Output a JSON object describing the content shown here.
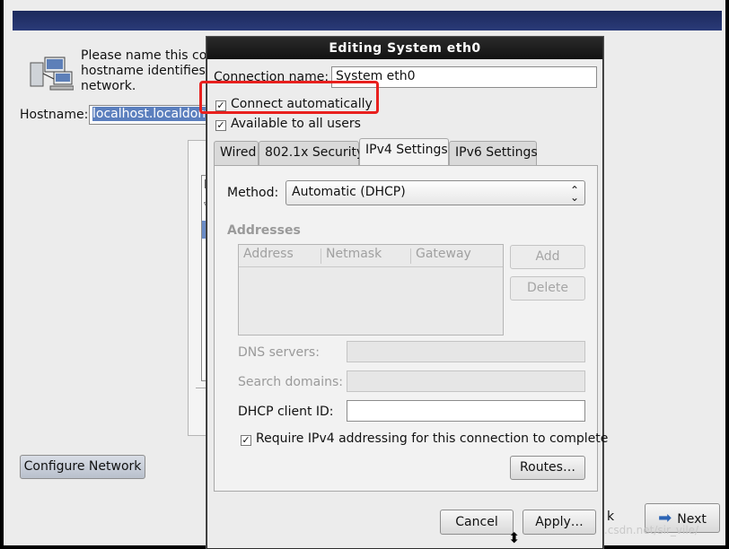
{
  "installer": {
    "intro_lines": [
      "Please name this com",
      "hostname identifies th",
      "network."
    ],
    "hostname_label": "Hostname:",
    "hostname_value": "localhost.localdoma",
    "bg_list_header": "N",
    "configure_button": "Configure Network",
    "back_button_partial": "k",
    "next_button": "Next",
    "watermark": "https://blog.csdn.net/sir_vile/"
  },
  "dialog": {
    "title": "Editing System eth0",
    "connection_name_label": "Connection name:",
    "connection_name_value": "System eth0",
    "connect_auto_label": "Connect automatically",
    "available_users_label": "Available to all users",
    "tabs": [
      "Wired",
      "802.1x Security",
      "IPv4 Settings",
      "IPv6 Settings"
    ],
    "active_tab": "IPv4 Settings",
    "method_label": "Method:",
    "method_value": "Automatic (DHCP)",
    "addresses_header": "Addresses",
    "columns": [
      "Address",
      "Netmask",
      "Gateway"
    ],
    "add_button": "Add",
    "delete_button": "Delete",
    "dns_label": "DNS servers:",
    "search_label": "Search domains:",
    "dhcp_label": "DHCP client ID:",
    "require_label": "Require IPv4 addressing for this connection to complete",
    "routes_button": "Routes…",
    "cancel_button": "Cancel",
    "apply_button": "Apply…"
  },
  "colors": {
    "highlight": "#e8201e",
    "selection": "#5b7fbe",
    "titlebar": "#1c2a5c"
  }
}
